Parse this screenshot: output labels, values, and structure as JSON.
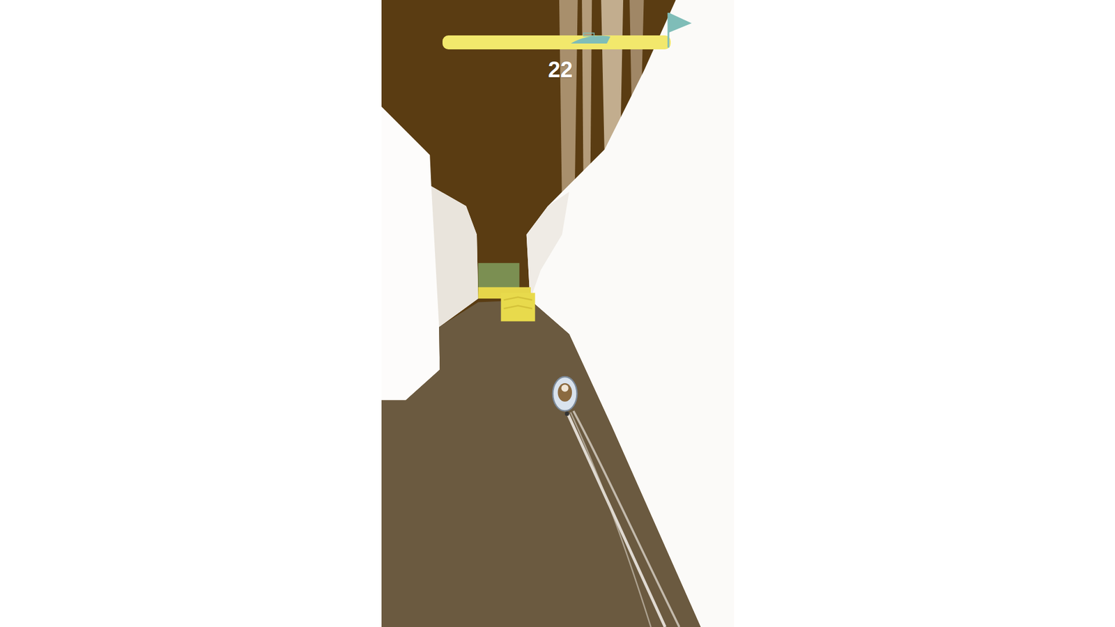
{
  "score": "22",
  "progress": {
    "level": 0.65
  }
}
